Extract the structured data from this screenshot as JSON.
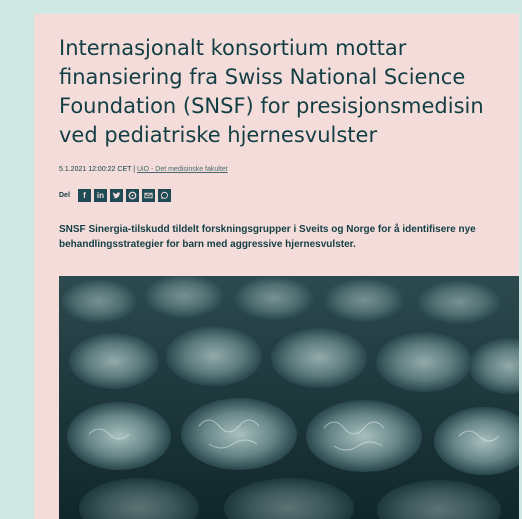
{
  "article": {
    "title": "Internasjonalt konsortium mottar finansiering fra Swiss National Science Foundation (SNSF) for presisjonsmedisin ved pediatriske hjernesvulster",
    "datetime": "5.1.2021 12:00:22 CET",
    "separator": " | ",
    "source_link": "UiO - Det medisinske fakultet",
    "share_label": "Del",
    "lead": "SNSF Sinergia-tilskudd tildelt forskningsgrupper i Sveits og Norge for å identifisere nye behandlingsstrategier for barn med aggressive hjernesvulster."
  },
  "share_icons": [
    "facebook-icon",
    "linkedin-icon",
    "twitter-icon",
    "pinterest-icon",
    "email-icon",
    "whatsapp-icon"
  ],
  "colors": {
    "background": "#cfe8e3",
    "card": "#f3dcd9",
    "text": "#123e44",
    "share_button": "#1f4b55"
  }
}
